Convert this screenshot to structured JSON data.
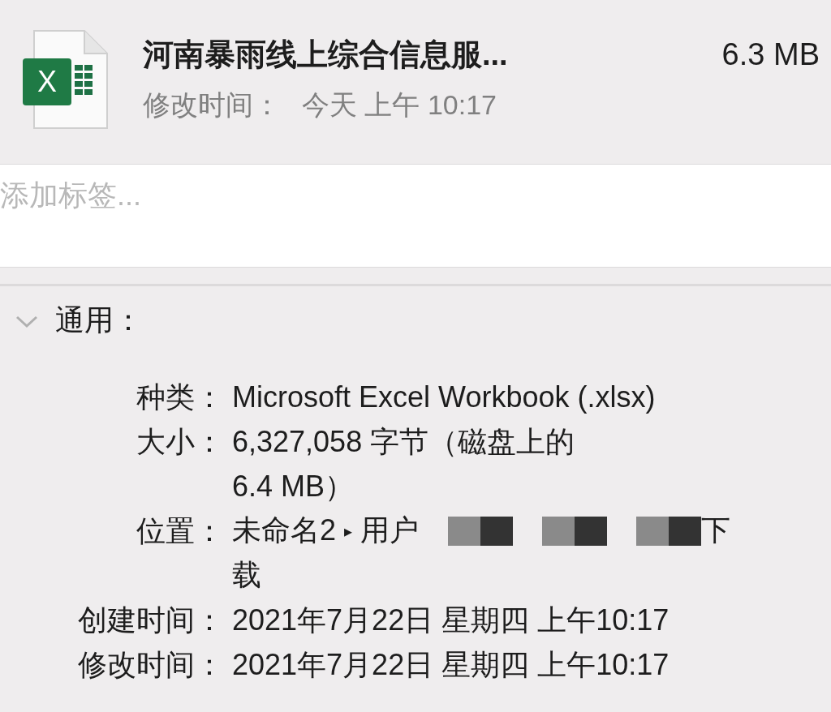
{
  "file": {
    "icon_letter": "X",
    "name": "河南暴雨线上综合信息服...",
    "size": "6.3 MB",
    "modified_label": "修改时间：",
    "modified_value": "今天 上午 10:17"
  },
  "tags_field": {
    "placeholder": "添加标签..."
  },
  "section": {
    "title": "通用：",
    "expanded": true,
    "rows": [
      {
        "kind": "text",
        "label": "种类：",
        "lines": [
          "Microsoft Excel Workbook (.xlsx)"
        ]
      },
      {
        "kind": "text",
        "label": "大小：",
        "lines": [
          "6,327,058 字节（磁盘上的",
          "6.4 MB）"
        ]
      },
      {
        "kind": "path",
        "label": "位置：",
        "lines": [
          [
            {
              "kind": "text",
              "text": "未命名2"
            },
            {
              "kind": "arrow",
              "text": "▸"
            },
            {
              "kind": "text",
              "text": "用户"
            },
            {
              "kind": "redacted"
            },
            {
              "kind": "redacted"
            },
            {
              "kind": "redacted"
            },
            {
              "kind": "text",
              "text": "下"
            }
          ],
          [
            {
              "kind": "text",
              "text": "载"
            }
          ]
        ]
      },
      {
        "kind": "text",
        "label": "创建时间：",
        "lines": [
          "2021年7月22日 星期四 上午10:17"
        ]
      },
      {
        "kind": "text",
        "label": "修改时间：",
        "lines": [
          "2021年7月22日 星期四 上午10:17"
        ]
      }
    ]
  }
}
